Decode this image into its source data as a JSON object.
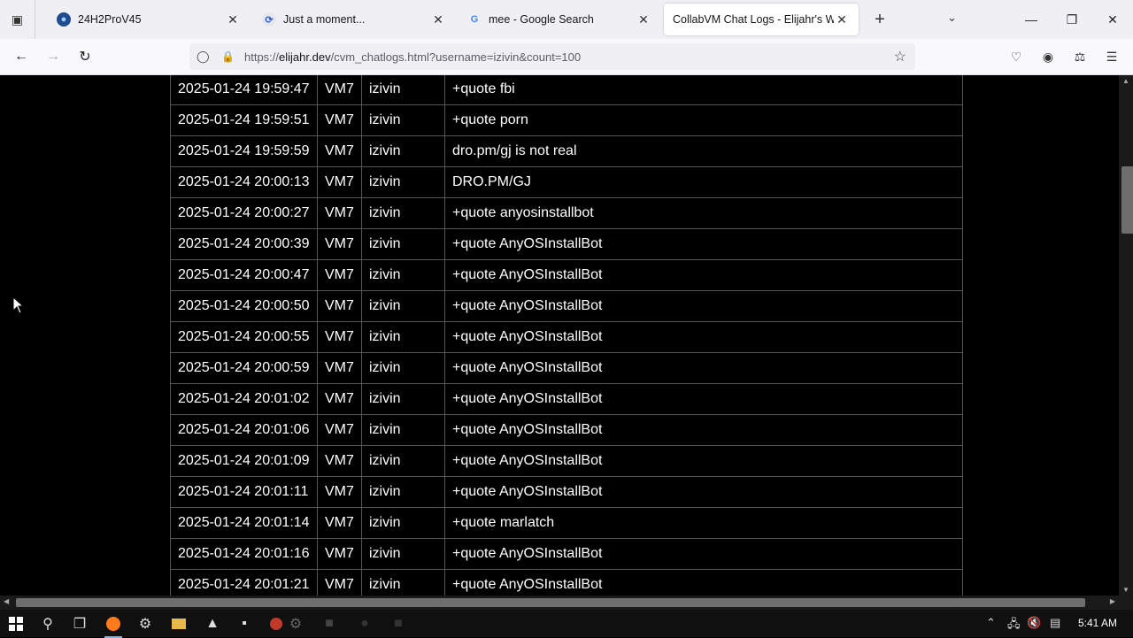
{
  "browser": {
    "tabs": [
      {
        "title": "24H2ProV45",
        "favicon": "globe-icon",
        "active": false
      },
      {
        "title": "Just a moment...",
        "favicon": "cloudflare-icon",
        "active": false
      },
      {
        "title": "mee - Google Search",
        "favicon": "google-icon",
        "active": false
      },
      {
        "title": "CollabVM Chat Logs - Elijahr's Web",
        "favicon": "none",
        "active": true
      }
    ],
    "url_prefix": "https://",
    "url_domain": "elijahr.dev",
    "url_path": "/cvm_chatlogs.html?username=izivin&count=100"
  },
  "logs": [
    {
      "time": "2025-01-24 19:59:47",
      "vm": "VM7",
      "user": "izivin",
      "message": "+quote fbi"
    },
    {
      "time": "2025-01-24 19:59:51",
      "vm": "VM7",
      "user": "izivin",
      "message": "+quote porn"
    },
    {
      "time": "2025-01-24 19:59:59",
      "vm": "VM7",
      "user": "izivin",
      "message": "dro.pm/gj is not real"
    },
    {
      "time": "2025-01-24 20:00:13",
      "vm": "VM7",
      "user": "izivin",
      "message": "DRO.PM/GJ"
    },
    {
      "time": "2025-01-24 20:00:27",
      "vm": "VM7",
      "user": "izivin",
      "message": "+quote anyosinstallbot"
    },
    {
      "time": "2025-01-24 20:00:39",
      "vm": "VM7",
      "user": "izivin",
      "message": "+quote AnyOSInstallBot"
    },
    {
      "time": "2025-01-24 20:00:47",
      "vm": "VM7",
      "user": "izivin",
      "message": "+quote AnyOSInstallBot"
    },
    {
      "time": "2025-01-24 20:00:50",
      "vm": "VM7",
      "user": "izivin",
      "message": "+quote AnyOSInstallBot"
    },
    {
      "time": "2025-01-24 20:00:55",
      "vm": "VM7",
      "user": "izivin",
      "message": "+quote AnyOSInstallBot"
    },
    {
      "time": "2025-01-24 20:00:59",
      "vm": "VM7",
      "user": "izivin",
      "message": "+quote AnyOSInstallBot"
    },
    {
      "time": "2025-01-24 20:01:02",
      "vm": "VM7",
      "user": "izivin",
      "message": "+quote AnyOSInstallBot"
    },
    {
      "time": "2025-01-24 20:01:06",
      "vm": "VM7",
      "user": "izivin",
      "message": "+quote AnyOSInstallBot"
    },
    {
      "time": "2025-01-24 20:01:09",
      "vm": "VM7",
      "user": "izivin",
      "message": "+quote AnyOSInstallBot"
    },
    {
      "time": "2025-01-24 20:01:11",
      "vm": "VM7",
      "user": "izivin",
      "message": "+quote AnyOSInstallBot"
    },
    {
      "time": "2025-01-24 20:01:14",
      "vm": "VM7",
      "user": "izivin",
      "message": "+quote marlatch"
    },
    {
      "time": "2025-01-24 20:01:16",
      "vm": "VM7",
      "user": "izivin",
      "message": "+quote AnyOSInstallBot"
    },
    {
      "time": "2025-01-24 20:01:21",
      "vm": "VM7",
      "user": "izivin",
      "message": "+quote AnyOSInstallBot"
    }
  ],
  "taskbar": {
    "clock": "5:41 AM"
  },
  "colors": {
    "page_bg": "#000000",
    "table_border": "#555555",
    "text": "#ffffff",
    "taskbar_bg": "#101010",
    "accent": "#76b9ed"
  }
}
